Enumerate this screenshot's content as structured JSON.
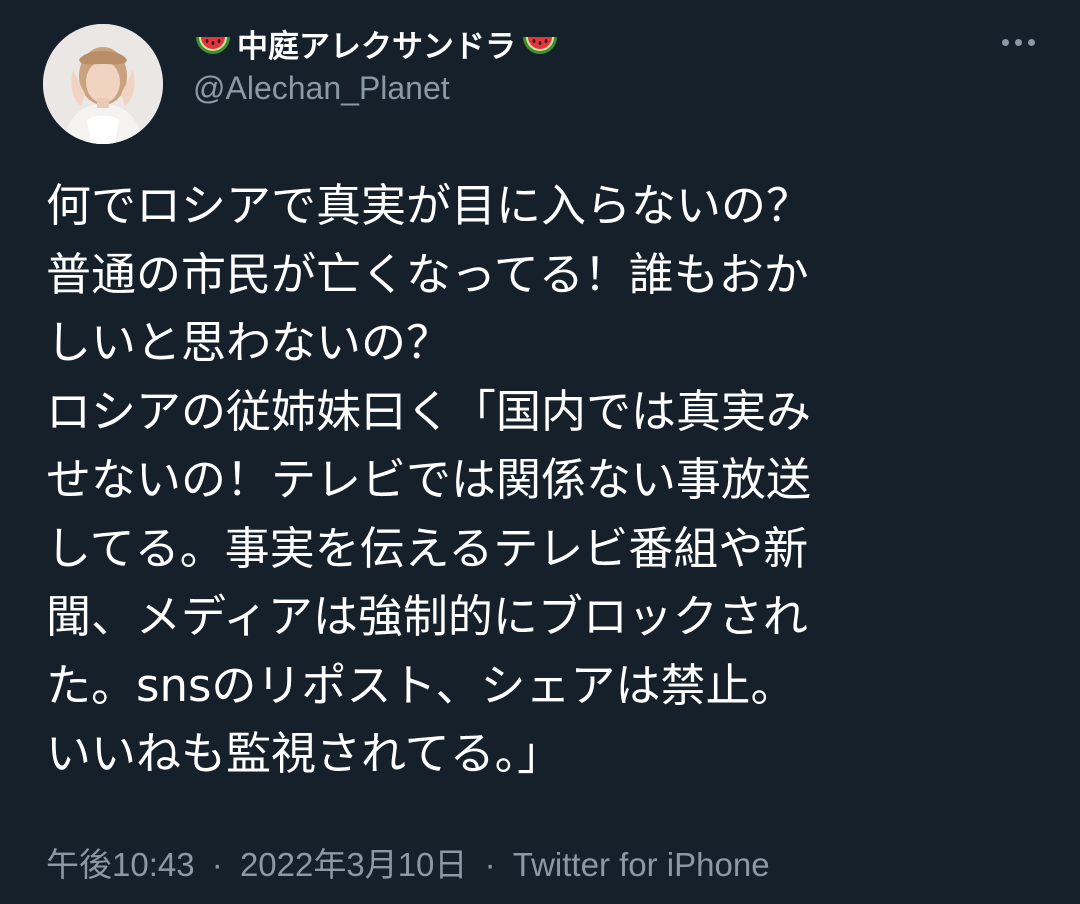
{
  "author": {
    "display_name": "中庭アレクサンドラ",
    "handle": "@Alechan_Planet",
    "name_emoji": "watermelon-icon"
  },
  "tweet": {
    "lines": [
      "何でロシアで真実が目に入らないの？",
      "普通の市民が亡くなってる！誰もおか",
      "しいと思わないの？",
      "ロシアの従姉妹曰く「国内では真実み",
      "せないの！テレビでは関係ない事放送",
      "してる。事実を伝えるテレビ番組や新",
      "聞、メディアは強制的にブロックされ",
      "た。snsのリポスト、シェアは禁止。",
      "いいねも監視されてる。」"
    ]
  },
  "meta": {
    "time": "午後10:43",
    "separator": "·",
    "date": "2022年3月10日",
    "source": "Twitter for iPhone"
  },
  "colors": {
    "background": "#15202b",
    "text": "#ffffff",
    "secondary": "#8b98a5"
  }
}
